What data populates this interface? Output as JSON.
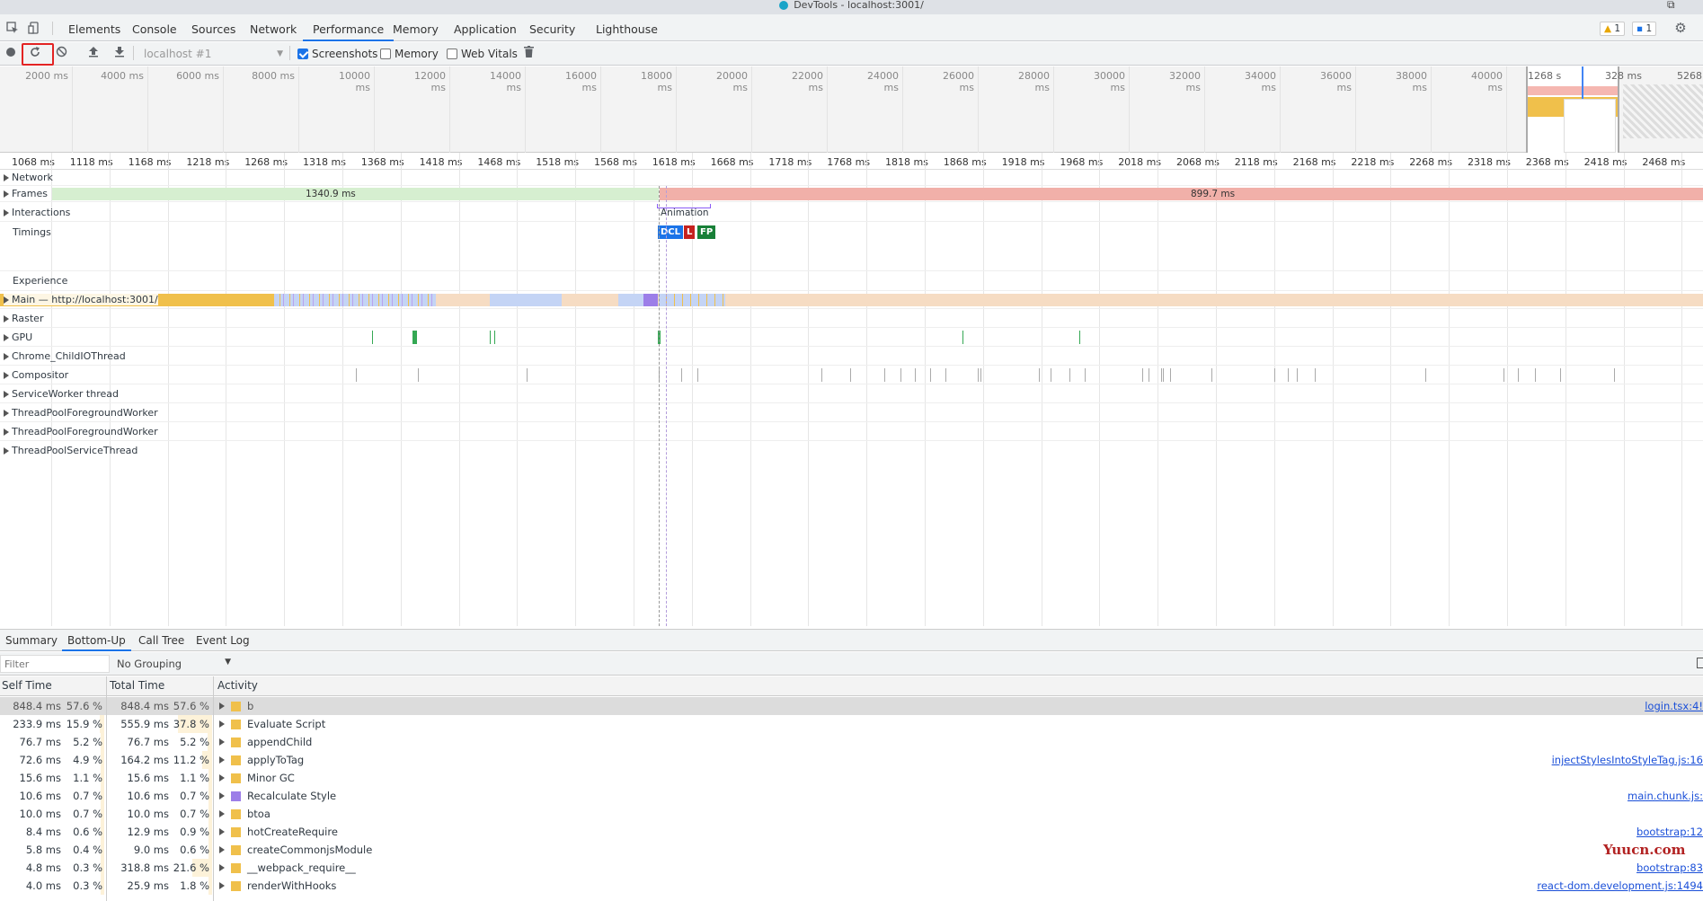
{
  "window": {
    "title": "DevTools - localhost:3001/"
  },
  "tabs": [
    "Elements",
    "Console",
    "Sources",
    "Network",
    "Performance",
    "Memory",
    "Application",
    "Security",
    "Lighthouse"
  ],
  "active_tab": "Performance",
  "badges": {
    "warnings": "1",
    "messages": "1"
  },
  "toolbar": {
    "profile_select": "localhost #1",
    "screenshots_label": "Screenshots",
    "screenshots_checked": true,
    "memory_label": "Memory",
    "memory_checked": false,
    "webvitals_label": "Web Vitals",
    "webvitals_checked": false
  },
  "overview": {
    "ticks": [
      "2000 ms",
      "4000 ms",
      "6000 ms",
      "8000 ms",
      "10000 ms",
      "12000 ms",
      "14000 ms",
      "16000 ms",
      "18000 ms",
      "20000 ms",
      "22000 ms",
      "24000 ms",
      "26000 ms",
      "28000 ms",
      "30000 ms",
      "32000 ms",
      "34000 ms",
      "36000 ms",
      "38000 ms",
      "40000 ms"
    ],
    "right_labels": [
      "1268",
      "s",
      "32",
      "8 ms",
      "5268"
    ]
  },
  "ruler": {
    "ticks": [
      "1068 ms",
      "1118 ms",
      "1168 ms",
      "1218 ms",
      "1268 ms",
      "1318 ms",
      "1368 ms",
      "1418 ms",
      "1468 ms",
      "1518 ms",
      "1568 ms",
      "1618 ms",
      "1668 ms",
      "1718 ms",
      "1768 ms",
      "1818 ms",
      "1868 ms",
      "1918 ms",
      "1968 ms",
      "2018 ms",
      "2068 ms",
      "2118 ms",
      "2168 ms",
      "2218 ms",
      "2268 ms",
      "2318 ms",
      "2368 ms",
      "2418 ms",
      "2468 ms"
    ]
  },
  "tracks": {
    "network": "Network",
    "frames": "Frames",
    "frame1": "1340.9 ms",
    "frame2": "899.7 ms",
    "interactions": "Interactions",
    "animation": "Animation",
    "timings": "Timings",
    "experience": "Experience",
    "main": "Main — http://localhost:3001/",
    "raster": "Raster",
    "gpu": "GPU",
    "childio": "Chrome_ChildIOThread",
    "compositor": "Compositor",
    "serviceworker": "ServiceWorker thread",
    "tp1": "ThreadPoolForegroundWorker",
    "tp2": "ThreadPoolForegroundWorker",
    "tps": "ThreadPoolServiceThread"
  },
  "markers": {
    "dcl": "DCL",
    "l": "L",
    "fp": "FP"
  },
  "bottom_tabs": [
    "Summary",
    "Bottom-Up",
    "Call Tree",
    "Event Log"
  ],
  "bottom_active": "Bottom-Up",
  "filter": {
    "placeholder": "Filter",
    "grouping": "No Grouping"
  },
  "columns": {
    "self": "Self Time",
    "total": "Total Time",
    "activity": "Activity"
  },
  "rows": [
    {
      "self": "848.4 ms",
      "self_pct": "57.6 %",
      "self_frac": 0.576,
      "total": "848.4 ms",
      "total_pct": "57.6 %",
      "total_frac": 0.576,
      "name": "b",
      "color": "#f0c04b",
      "link": "login.tsx:4!",
      "selected": true
    },
    {
      "self": "233.9 ms",
      "self_pct": "15.9 %",
      "self_frac": 0.159,
      "total": "555.9 ms",
      "total_pct": "37.8 %",
      "total_frac": 0.378,
      "name": "Evaluate Script",
      "color": "#f0c04b",
      "link": ""
    },
    {
      "self": "76.7 ms",
      "self_pct": "5.2 %",
      "self_frac": 0.052,
      "total": "76.7 ms",
      "total_pct": "5.2 %",
      "total_frac": 0.052,
      "name": "appendChild",
      "color": "#f0c04b",
      "link": ""
    },
    {
      "self": "72.6 ms",
      "self_pct": "4.9 %",
      "self_frac": 0.049,
      "total": "164.2 ms",
      "total_pct": "11.2 %",
      "total_frac": 0.112,
      "name": "applyToTag",
      "color": "#f0c04b",
      "link": "injectStylesIntoStyleTag.js:16"
    },
    {
      "self": "15.6 ms",
      "self_pct": "1.1 %",
      "self_frac": 0.011,
      "total": "15.6 ms",
      "total_pct": "1.1 %",
      "total_frac": 0.011,
      "name": "Minor GC",
      "color": "#f0c04b",
      "link": ""
    },
    {
      "self": "10.6 ms",
      "self_pct": "0.7 %",
      "self_frac": 0.007,
      "total": "10.6 ms",
      "total_pct": "0.7 %",
      "total_frac": 0.007,
      "name": "Recalculate Style",
      "color": "#9c7ee8",
      "link": "main.chunk.js:"
    },
    {
      "self": "10.0 ms",
      "self_pct": "0.7 %",
      "self_frac": 0.007,
      "total": "10.0 ms",
      "total_pct": "0.7 %",
      "total_frac": 0.007,
      "name": "btoa",
      "color": "#f0c04b",
      "link": ""
    },
    {
      "self": "8.4 ms",
      "self_pct": "0.6 %",
      "self_frac": 0.006,
      "total": "12.9 ms",
      "total_pct": "0.9 %",
      "total_frac": 0.009,
      "name": "hotCreateRequire",
      "color": "#f0c04b",
      "link": "bootstrap:12"
    },
    {
      "self": "5.8 ms",
      "self_pct": "0.4 %",
      "self_frac": 0.004,
      "total": "9.0 ms",
      "total_pct": "0.6 %",
      "total_frac": 0.006,
      "name": "createCommonjsModule",
      "color": "#f0c04b",
      "link": ""
    },
    {
      "self": "4.8 ms",
      "self_pct": "0.3 %",
      "self_frac": 0.003,
      "total": "318.8 ms",
      "total_pct": "21.6 %",
      "total_frac": 0.216,
      "name": "__webpack_require__",
      "color": "#f0c04b",
      "link": "bootstrap:83"
    },
    {
      "self": "4.0 ms",
      "self_pct": "0.3 %",
      "self_frac": 0.003,
      "total": "25.9 ms",
      "total_pct": "1.8 %",
      "total_frac": 0.018,
      "name": "renderWithHooks",
      "color": "#f0c04b",
      "link": "react-dom.development.js:1494"
    }
  ],
  "watermark": "Yuucn.com"
}
